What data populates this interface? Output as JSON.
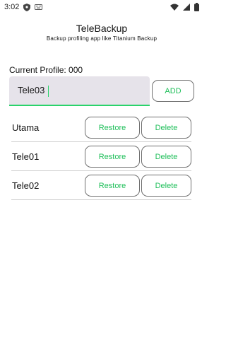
{
  "status_bar": {
    "time": "3:02"
  },
  "app": {
    "title": "TeleBackup",
    "subtitle": "Backup profiling app like Titanium Backup"
  },
  "current_profile": {
    "text": "Current Profile: 000"
  },
  "profile_input": {
    "value": "Tele03",
    "placeholder": ""
  },
  "add_button": {
    "label": "ADD"
  },
  "profiles": [
    {
      "name": "Utama",
      "restore_label": "Restore",
      "delete_label": "Delete"
    },
    {
      "name": "Tele01",
      "restore_label": "Restore",
      "delete_label": "Delete"
    },
    {
      "name": "Tele02",
      "restore_label": "Restore",
      "delete_label": "Delete"
    }
  ],
  "colors": {
    "accent": "#1fbf5a",
    "input_underline": "#2ad36b",
    "input_background": "#e6e3ea"
  },
  "icons": {
    "status_left": [
      "shield-icon",
      "keyboard-icon"
    ],
    "status_right": [
      "wifi-icon",
      "signal-icon",
      "battery-icon"
    ]
  }
}
